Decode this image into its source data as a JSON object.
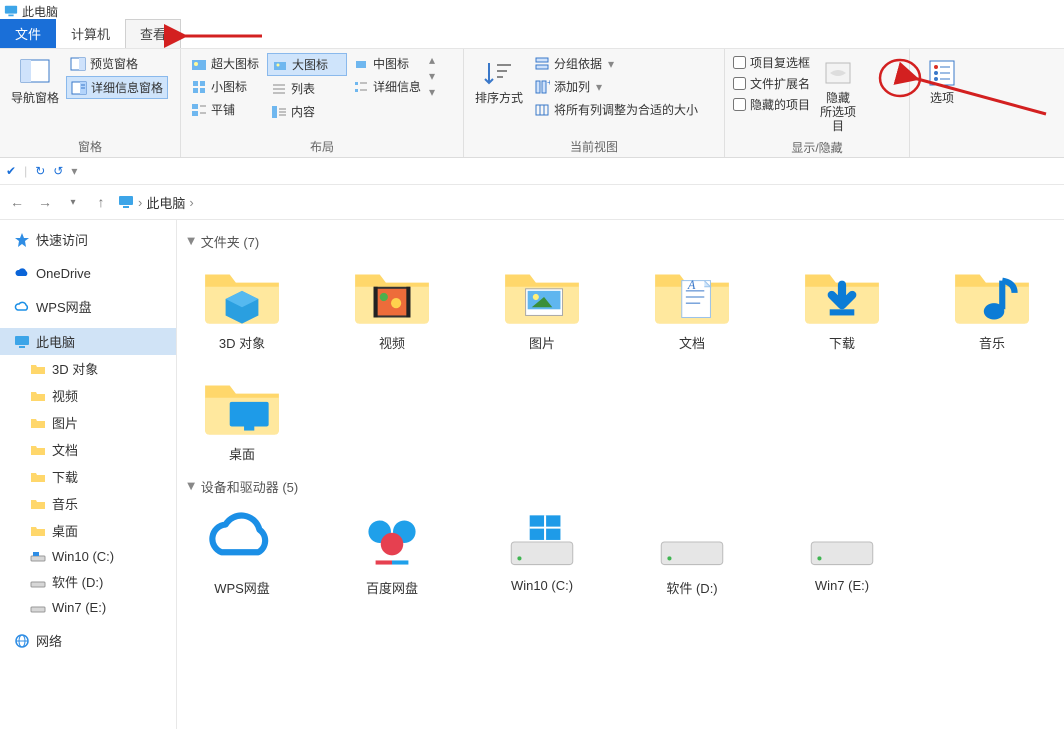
{
  "window": {
    "title": "此电脑"
  },
  "tabs": {
    "file": "文件",
    "computer": "计算机",
    "view": "查看"
  },
  "ribbon": {
    "panes": {
      "label": "窗格",
      "nav": "导航窗格",
      "preview": "预览窗格",
      "details": "详细信息窗格"
    },
    "layout": {
      "label": "布局",
      "xlarge": "超大图标",
      "large": "大图标",
      "medium": "中图标",
      "small": "小图标",
      "list": "列表",
      "details": "详细信息",
      "tiles": "平铺",
      "content": "内容"
    },
    "currentview": {
      "label": "当前视图",
      "sort": "排序方式",
      "groupby": "分组依据",
      "addcols": "添加列",
      "sizecols": "将所有列调整为合适的大小"
    },
    "showhide": {
      "label": "显示/隐藏",
      "itemcheck": "项目复选框",
      "fileext": "文件扩展名",
      "hiddenitems": "隐藏的项目",
      "hidesel": "隐藏\n所选项目"
    },
    "options": "选项"
  },
  "breadcrumb": {
    "root": "此电脑"
  },
  "sidebar": {
    "quick": "快速访问",
    "onedrive": "OneDrive",
    "wpscloud": "WPS网盘",
    "thispc": "此电脑",
    "children": [
      "3D 对象",
      "视频",
      "图片",
      "文档",
      "下载",
      "音乐",
      "桌面",
      "Win10 (C:)",
      "软件 (D:)",
      "Win7 (E:)"
    ],
    "network": "网络"
  },
  "sections": {
    "folders": {
      "label": "文件夹",
      "count": 7
    },
    "devices": {
      "label": "设备和驱动器",
      "count": 5
    }
  },
  "folders": [
    {
      "name": "3D 对象",
      "icon": "3d"
    },
    {
      "name": "视频",
      "icon": "video"
    },
    {
      "name": "图片",
      "icon": "pictures"
    },
    {
      "name": "文档",
      "icon": "documents"
    },
    {
      "name": "下载",
      "icon": "downloads"
    },
    {
      "name": "音乐",
      "icon": "music"
    },
    {
      "name": "桌面",
      "icon": "desktop"
    }
  ],
  "devices": [
    {
      "name": "WPS网盘",
      "icon": "wps"
    },
    {
      "name": "百度网盘",
      "icon": "baidu"
    },
    {
      "name": "Win10 (C:)",
      "icon": "drive-win"
    },
    {
      "name": "软件 (D:)",
      "icon": "drive"
    },
    {
      "name": "Win7 (E:)",
      "icon": "drive"
    }
  ]
}
